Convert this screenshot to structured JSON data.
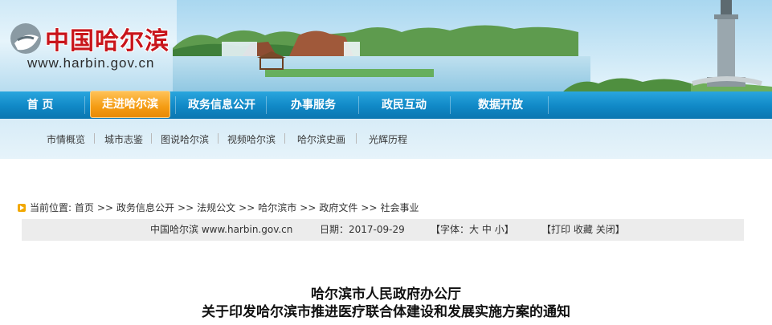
{
  "header": {
    "logo_title": "中国哈尔滨",
    "logo_url": "www.harbin.gov.cn"
  },
  "nav": {
    "items": [
      {
        "label": "首 页",
        "active": false
      },
      {
        "label": "走进哈尔滨",
        "active": true
      },
      {
        "label": "政务信息公开",
        "active": false
      },
      {
        "label": "办事服务",
        "active": false
      },
      {
        "label": "政民互动",
        "active": false
      },
      {
        "label": "数据开放",
        "active": false
      }
    ]
  },
  "subnav": {
    "items": [
      "市情概览",
      "城市志鉴",
      "图说哈尔滨",
      "视频哈尔滨",
      "哈尔滨史画",
      "光辉历程"
    ]
  },
  "breadcrumb": {
    "prefix": "当前位置:",
    "items": [
      "首页",
      "政务信息公开",
      "法规公文",
      "哈尔滨市",
      "政府文件",
      "社会事业"
    ],
    "separator": ">>"
  },
  "info_bar": {
    "source": "中国哈尔滨 www.harbin.gov.cn",
    "date": "日期：2017-09-29",
    "font_open": "【字体：",
    "font_large": "大",
    "font_medium": "中",
    "font_small": "小",
    "font_close": "】",
    "actions_open": "【",
    "print": "打印",
    "favorite": "收藏",
    "close": "关闭",
    "actions_close": "】"
  },
  "article": {
    "title_line1": "哈尔滨市人民政府办公厅",
    "title_line2": "关于印发哈尔滨市推进医疗联合体建设和发展实施方案的通知"
  },
  "colors": {
    "nav_blue": "#1088c6",
    "nav_active_orange": "#f49c13",
    "logo_red": "#c8151b",
    "info_bar_bg": "#ececec"
  }
}
